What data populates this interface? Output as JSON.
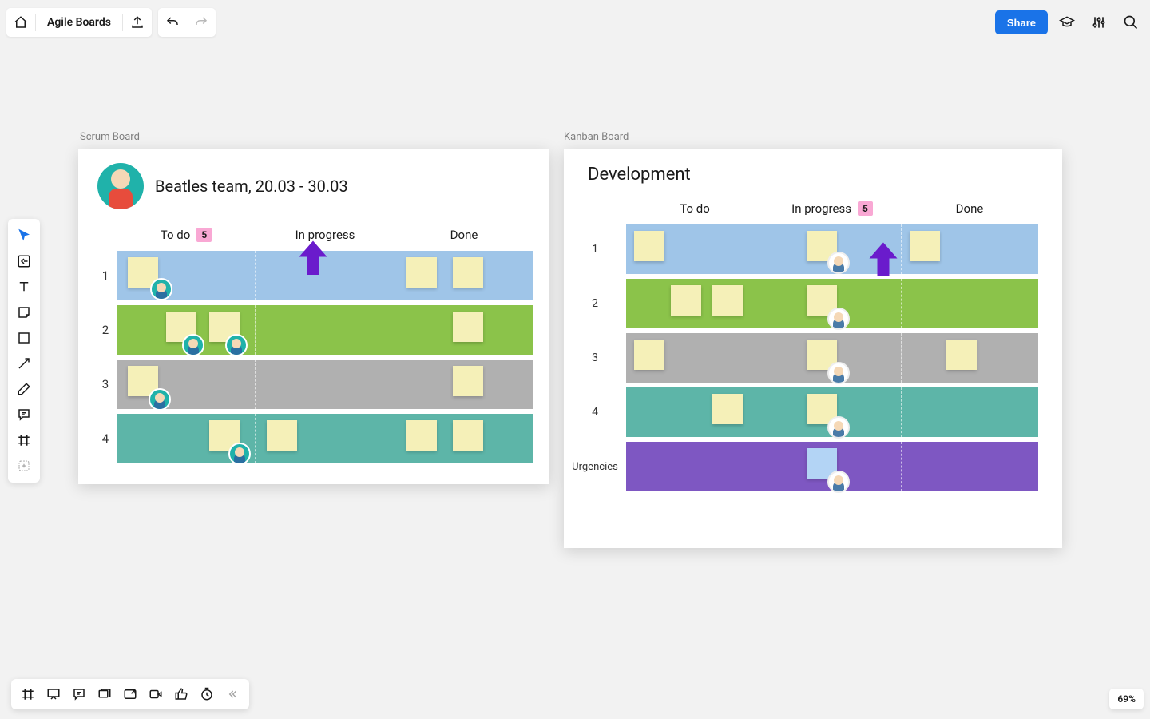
{
  "header": {
    "title": "Agile Boards",
    "share_label": "Share"
  },
  "zoom": {
    "level": "69%"
  },
  "scrum": {
    "label": "Scrum Board",
    "title": "Beatles team, 20.03 - 30.03",
    "columns": [
      {
        "label": "To do",
        "badge": "5"
      },
      {
        "label": "In progress"
      },
      {
        "label": "Done"
      }
    ],
    "rows": [
      {
        "num": "1",
        "color": "r-blue"
      },
      {
        "num": "2",
        "color": "r-green"
      },
      {
        "num": "3",
        "color": "r-gray"
      },
      {
        "num": "4",
        "color": "r-teal"
      }
    ]
  },
  "kanban": {
    "label": "Kanban Board",
    "title": "Development",
    "columns": [
      {
        "label": "To do"
      },
      {
        "label": "In progress",
        "badge": "5"
      },
      {
        "label": "Done"
      }
    ],
    "rows": [
      {
        "num": "1",
        "color": "r-blue"
      },
      {
        "num": "2",
        "color": "r-green"
      },
      {
        "num": "3",
        "color": "r-gray"
      },
      {
        "num": "4",
        "color": "r-teal"
      },
      {
        "num": "Urgencies",
        "color": "r-purple"
      }
    ]
  }
}
